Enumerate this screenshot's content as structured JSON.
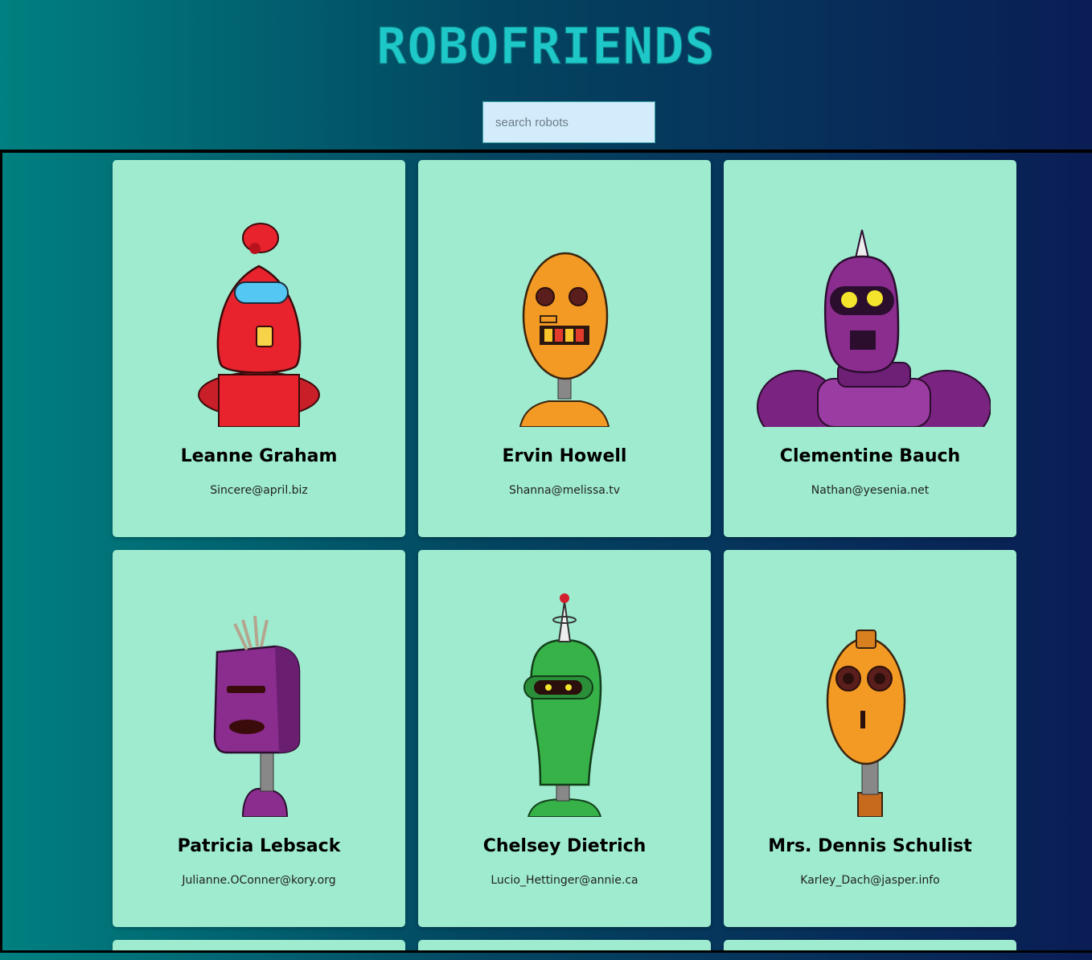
{
  "app": {
    "title": "ROBOFRIENDS"
  },
  "search": {
    "placeholder": "search robots",
    "value": ""
  },
  "robots": [
    {
      "name": "Leanne Graham",
      "email": "Sincere@april.biz",
      "color": "#e8232e"
    },
    {
      "name": "Ervin Howell",
      "email": "Shanna@melissa.tv",
      "color": "#f39a24"
    },
    {
      "name": "Clementine Bauch",
      "email": "Nathan@yesenia.net",
      "color": "#8a2d8f"
    },
    {
      "name": "Patricia Lebsack",
      "email": "Julianne.OConner@kory.org",
      "color": "#8a2d8f"
    },
    {
      "name": "Chelsey Dietrich",
      "email": "Lucio_Hettinger@annie.ca",
      "color": "#36b249"
    },
    {
      "name": "Mrs. Dennis Schulist",
      "email": "Karley_Dach@jasper.info",
      "color": "#f39a24"
    }
  ],
  "colors": {
    "card_bg": "#9eebcf",
    "title": "#1ec8c8",
    "search_bg": "#d3ecfc"
  }
}
